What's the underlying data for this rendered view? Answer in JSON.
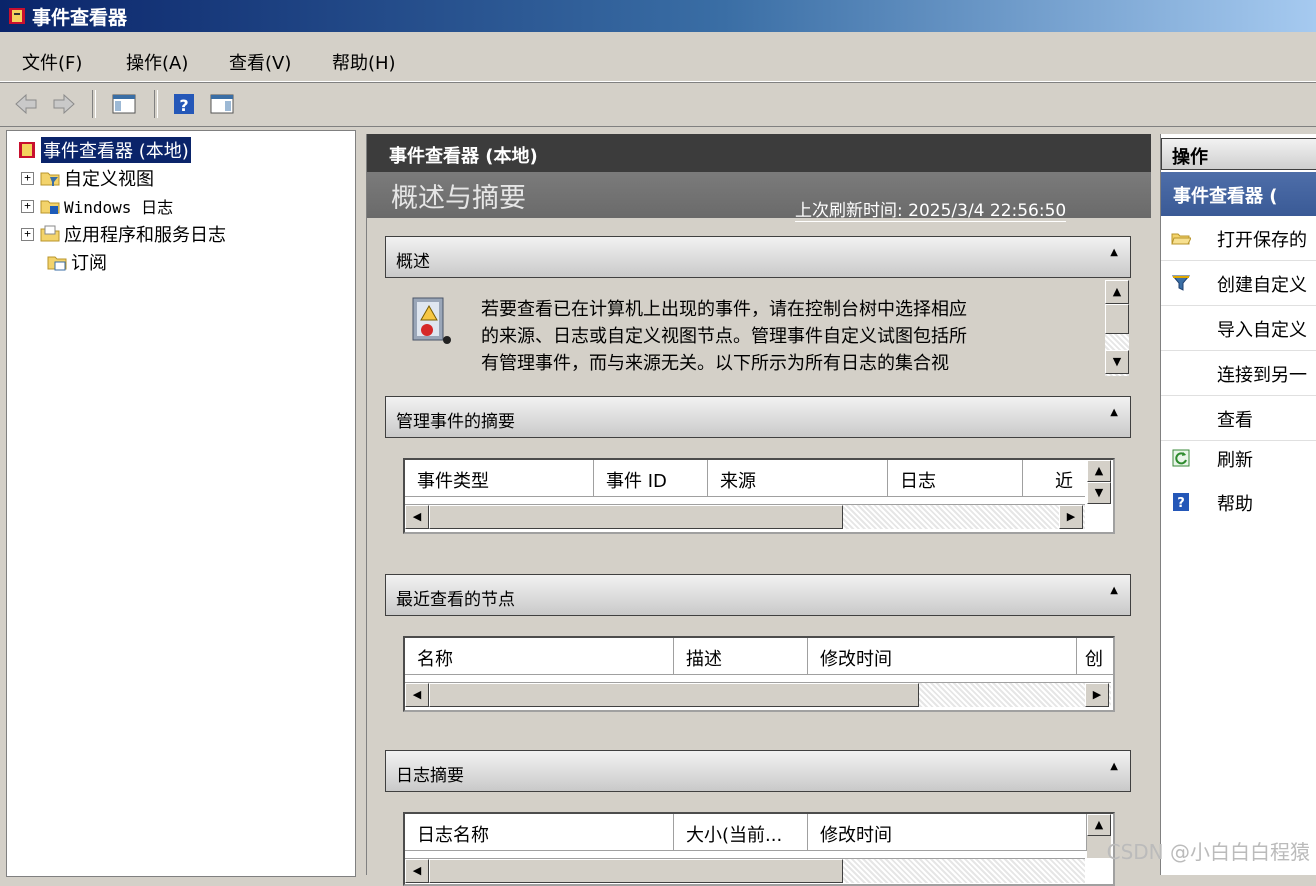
{
  "window": {
    "title": "事件查看器"
  },
  "menu": {
    "items": [
      "文件(F)",
      "操作(A)",
      "查看(V)",
      "帮助(H)"
    ]
  },
  "tree": {
    "items": [
      {
        "label": "事件查看器 (本地)",
        "selected": true,
        "expandable": false
      },
      {
        "label": "自定义视图",
        "expandable": true
      },
      {
        "label": "Windows 日志",
        "expandable": true
      },
      {
        "label": "应用程序和服务日志",
        "expandable": true
      },
      {
        "label": "订阅",
        "expandable": false
      }
    ]
  },
  "center": {
    "header": "事件查看器 (本地)",
    "overview_title": "概述与摘要",
    "refresh": "上次刷新时间: 2025/3/4 22:56:50",
    "panels": {
      "overview": {
        "title": "概述",
        "text_line1": "若要查看已在计算机上出现的事件，请在控制台树中选择相应",
        "text_line2": "的来源、日志或自定义视图节点。管理事件自定义试图包括所",
        "text_line3": "有管理事件，而与来源无关。以下所示为所有日志的集合视"
      },
      "admin_summary": {
        "title": "管理事件的摘要",
        "columns": [
          "事件类型",
          "事件 ID",
          "来源",
          "日志",
          "近"
        ]
      },
      "recent_nodes": {
        "title": "最近查看的节点",
        "columns": [
          "名称",
          "描述",
          "修改时间",
          "创"
        ]
      },
      "log_summary": {
        "title": "日志摘要",
        "columns": [
          "日志名称",
          "大小(当前...",
          "修改时间"
        ]
      }
    }
  },
  "actions": {
    "header": "操作",
    "sub_header": "事件查看器 (",
    "items": [
      {
        "label": "打开保存的",
        "icon": "folder-open-icon"
      },
      {
        "label": "创建自定义",
        "icon": "filter-icon"
      },
      {
        "label": "导入自定义",
        "icon": ""
      },
      {
        "label": "连接到另一",
        "icon": ""
      },
      {
        "label": "查看",
        "icon": ""
      },
      {
        "label": "刷新",
        "icon": "refresh-icon"
      },
      {
        "label": "帮助",
        "icon": "help-icon"
      }
    ]
  },
  "watermark": "CSDN @小白白白程猿"
}
